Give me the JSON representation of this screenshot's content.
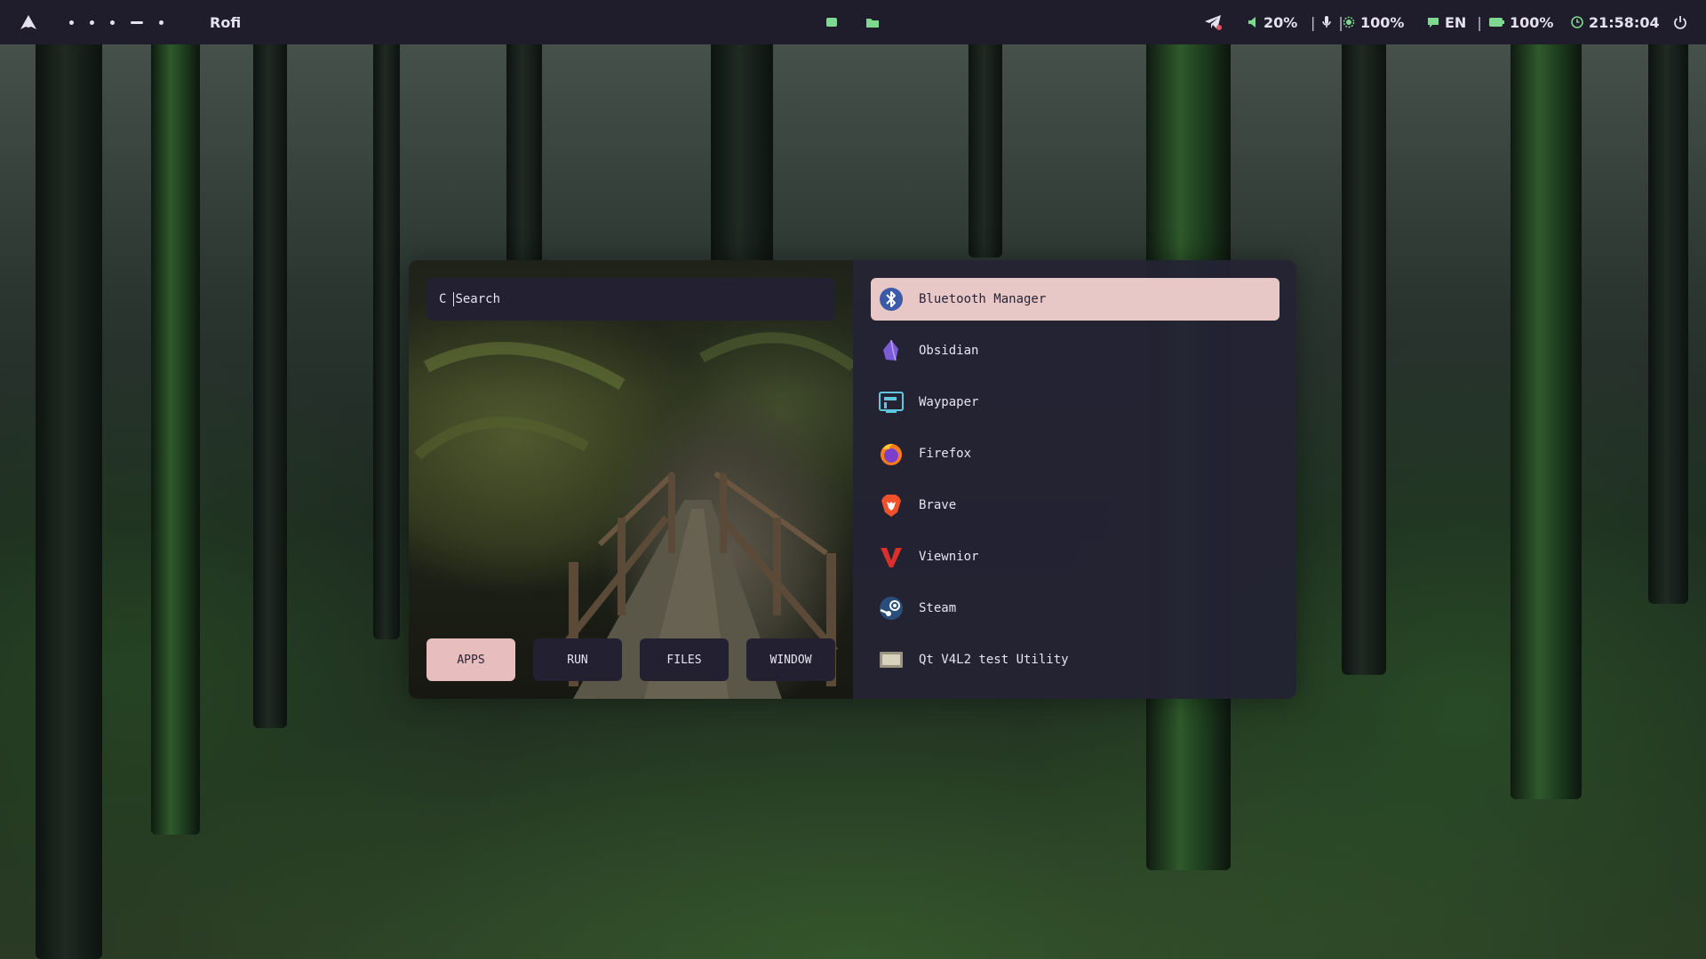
{
  "topbar": {
    "launcher_icon": "arch-logo-icon",
    "workspace_count": 5,
    "active_window_title": "Rofi",
    "center_icons": [
      "terminal-icon",
      "folder-icon"
    ],
    "right": {
      "telegram_icon": "telegram-icon",
      "volume": "20%",
      "separator": "|",
      "brightness": "100%",
      "language": "EN",
      "battery": "100%",
      "clock": "21:58:04",
      "power_icon": "power-icon"
    },
    "colors": {
      "bar_bg": "#1f1d2b",
      "accent_green": "#7fd88f"
    }
  },
  "rofi": {
    "search": {
      "icon_glyph": "C",
      "placeholder": "Search"
    },
    "modes": [
      {
        "label": "APPS",
        "active": true
      },
      {
        "label": "RUN",
        "active": false
      },
      {
        "label": "FILES",
        "active": false
      },
      {
        "label": "WINDOW",
        "active": false
      }
    ],
    "apps": [
      {
        "name": "Bluetooth Manager",
        "icon": "bluetooth-icon",
        "selected": true
      },
      {
        "name": "Obsidian",
        "icon": "obsidian-icon",
        "selected": false
      },
      {
        "name": "Waypaper",
        "icon": "waypaper-icon",
        "selected": false
      },
      {
        "name": "Firefox",
        "icon": "firefox-icon",
        "selected": false
      },
      {
        "name": "Brave",
        "icon": "brave-icon",
        "selected": false
      },
      {
        "name": "Viewnior",
        "icon": "viewnior-icon",
        "selected": false
      },
      {
        "name": "Steam",
        "icon": "steam-icon",
        "selected": false
      },
      {
        "name": "Qt V4L2 test Utility",
        "icon": "qt-v4l2-icon",
        "selected": false
      }
    ],
    "colors": {
      "panel_bg": "#242234",
      "selected_bg": "#e8c7c7",
      "active_mode_bg": "#e8bdbd"
    }
  }
}
